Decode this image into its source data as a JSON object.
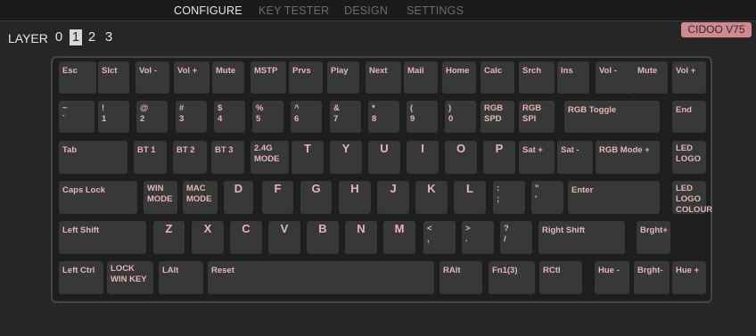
{
  "nav": {
    "tabs": [
      "CONFIGURE",
      "KEY TESTER",
      "DESIGN",
      "SETTINGS"
    ],
    "active_tab": "CONFIGURE"
  },
  "layer": {
    "label": "LAYER",
    "options": [
      "0",
      "1",
      "2",
      "3"
    ],
    "selected": "1"
  },
  "device": {
    "name": "CIDOO V75"
  },
  "keyboard": {
    "row1": [
      "Esc",
      "Slct",
      "Vol -",
      "Vol +",
      "Mute",
      "MSTP",
      "Prvs",
      "Play",
      "Next",
      "Mail",
      "Home",
      "Calc",
      "Srch",
      "Ins",
      "Vol -",
      "Mute",
      "Vol +"
    ],
    "row2": [
      [
        "~",
        "`"
      ],
      [
        "!",
        "1"
      ],
      [
        "@",
        "2"
      ],
      [
        "#",
        "3"
      ],
      [
        "$",
        "4"
      ],
      [
        "%",
        "5"
      ],
      [
        "^",
        "6"
      ],
      [
        "&",
        "7"
      ],
      [
        "*",
        "8"
      ],
      [
        "(",
        "9"
      ],
      [
        ")",
        "0"
      ],
      [
        "RGB",
        "SPD"
      ],
      [
        "RGB",
        "SPI"
      ],
      [
        "RGB Toggle"
      ],
      [
        "End"
      ]
    ],
    "row3": [
      [
        "Tab"
      ],
      [
        "BT 1"
      ],
      [
        "BT 2"
      ],
      [
        "BT 3"
      ],
      [
        "2.4G",
        "MODE"
      ],
      [
        "T"
      ],
      [
        "Y"
      ],
      [
        "U"
      ],
      [
        "I"
      ],
      [
        "O"
      ],
      [
        "P"
      ],
      [
        "Sat +"
      ],
      [
        "Sat -"
      ],
      [
        "RGB Mode +"
      ],
      [
        "LED",
        "LOGO"
      ]
    ],
    "row4": [
      [
        "Caps Lock"
      ],
      [
        "WIN",
        "MODE"
      ],
      [
        "MAC",
        "MODE"
      ],
      [
        "D"
      ],
      [
        "F"
      ],
      [
        "G"
      ],
      [
        "H"
      ],
      [
        "J"
      ],
      [
        "K"
      ],
      [
        "L"
      ],
      [
        ":",
        ";"
      ],
      [
        "\"",
        "'"
      ],
      [
        "Enter"
      ],
      [
        "LED",
        "LOGO",
        "COLOUR"
      ]
    ],
    "row5": [
      [
        "Left Shift"
      ],
      [
        "Z"
      ],
      [
        "X"
      ],
      [
        "C"
      ],
      [
        "V"
      ],
      [
        "B"
      ],
      [
        "N"
      ],
      [
        "M"
      ],
      [
        "<",
        ","
      ],
      [
        ">",
        "."
      ],
      [
        "?",
        "/"
      ],
      [
        "Right Shift"
      ],
      [
        "Brght+"
      ]
    ],
    "row6": [
      [
        "Left Ctrl"
      ],
      [
        "LOCK",
        "WIN KEY"
      ],
      [
        "LAlt"
      ],
      [
        "Reset"
      ],
      [
        "RAlt"
      ],
      [
        "Fn1(3)"
      ],
      [
        "RCtl"
      ],
      [
        "Hue -"
      ],
      [
        "Brght-"
      ],
      [
        "Hue +"
      ]
    ]
  }
}
